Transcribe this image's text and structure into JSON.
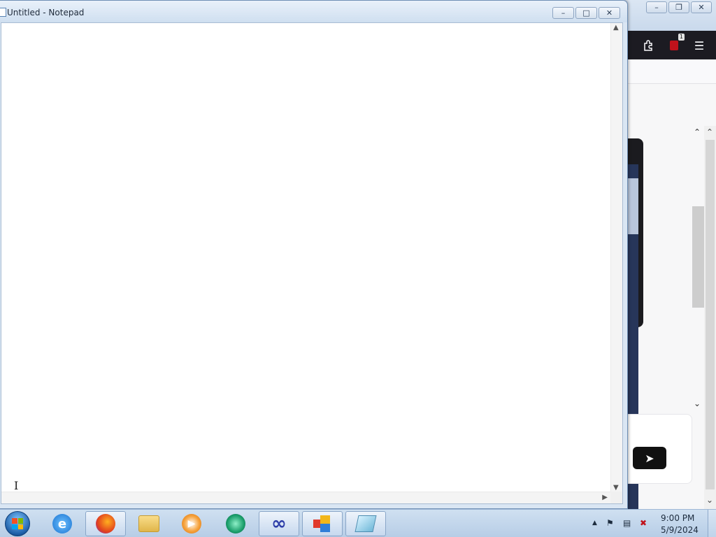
{
  "notepad": {
    "title": "Untitled - Notepad",
    "text": "",
    "caption": {
      "minimize": "–",
      "maximize": "□",
      "close": "✕"
    }
  },
  "browser": {
    "caption": {
      "minimize": "–",
      "restore": "❐",
      "close": "✕"
    },
    "extension_badge": "1",
    "menu_icon": "☰",
    "send_icon": "➤"
  },
  "taskbar": {
    "apps": [
      {
        "name": "Internet Explorer",
        "icon": "internet-explorer-icon"
      },
      {
        "name": "Firefox",
        "icon": "firefox-icon"
      },
      {
        "name": "Windows Explorer",
        "icon": "folder-icon"
      },
      {
        "name": "Media Player",
        "icon": "media-player-icon"
      },
      {
        "name": "App",
        "icon": "green-app-icon"
      },
      {
        "name": "App",
        "icon": "infinity-app-icon"
      },
      {
        "name": "Control Panel",
        "icon": "control-panel-icon"
      },
      {
        "name": "Notepad",
        "icon": "notepad-icon"
      }
    ],
    "tray": {
      "show_hidden": "▲",
      "time": "9:00 PM",
      "date": "5/9/2024"
    }
  },
  "colors": {
    "browser_toolbar": "#1c1b22",
    "navy_strip": "#27365a",
    "taskbar": "#c3d6ec"
  }
}
